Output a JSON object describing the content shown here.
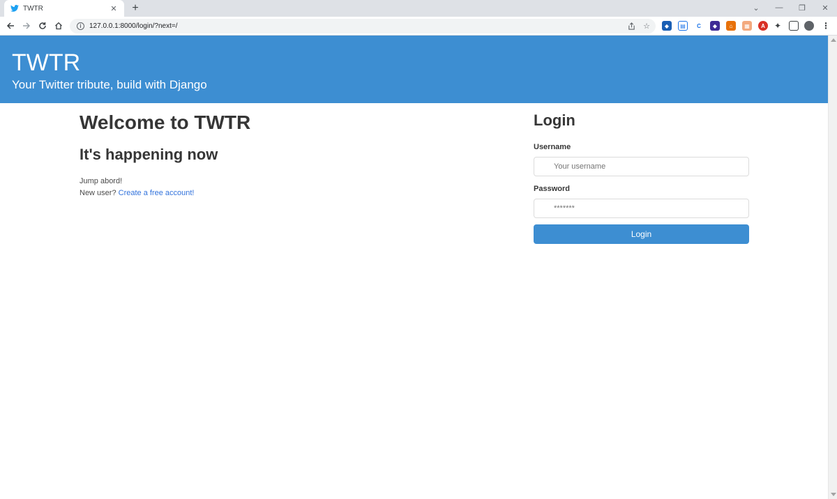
{
  "browser": {
    "tab_title": "TWTR",
    "tab_close": "✕",
    "new_tab": "+",
    "url": "127.0.0.1:8000/login/?next=/",
    "window_controls": {
      "collapse": "⌄",
      "minimize": "—",
      "restore": "❐",
      "close": "✕"
    }
  },
  "header": {
    "brand": "TWTR",
    "tagline": "Your Twitter tribute, build with Django"
  },
  "intro": {
    "title": "Welcome to TWTR",
    "subtitle": "It's happening now",
    "jump_text": "Jump abord!",
    "new_user_prefix": "New user? ",
    "signup_link": "Create a free account!"
  },
  "login": {
    "title": "Login",
    "username_label": "Username",
    "username_placeholder": "Your username",
    "password_label": "Password",
    "password_placeholder": "*******",
    "submit_label": "Login"
  },
  "colors": {
    "brand_blue": "#3d8ed2",
    "link_blue": "#3273dc"
  }
}
